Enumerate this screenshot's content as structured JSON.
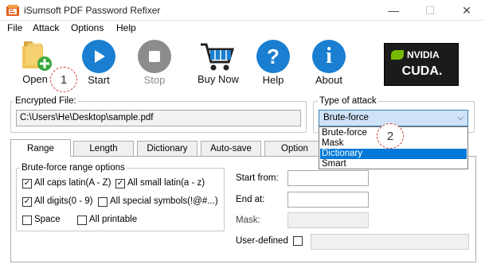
{
  "window": {
    "title": "iSumsoft PDF Password Refixer",
    "minimize": "—",
    "maximize": "☐",
    "close": "✕"
  },
  "menu": [
    "File",
    "Attack",
    "Options",
    "Help"
  ],
  "toolbar": {
    "open": "Open",
    "start": "Start",
    "stop": "Stop",
    "buy_now": "Buy Now",
    "help": "Help",
    "about": "About",
    "nvidia_line1": "NVIDIA",
    "nvidia_line2": "CUDA."
  },
  "callouts": [
    "1",
    "2"
  ],
  "encrypted_file": {
    "label": "Encrypted File:",
    "value": "C:\\Users\\He\\Desktop\\sample.pdf"
  },
  "attack_type": {
    "label": "Type of attack",
    "selected": "Brute-force",
    "options": [
      "Brute-force",
      "Mask",
      "Dictionary",
      "Smart"
    ],
    "highlighted": "Dictionary"
  },
  "tabs": [
    "Range",
    "Length",
    "Dictionary",
    "Auto-save",
    "Option"
  ],
  "range": {
    "group_label": "Brute-force range options",
    "options": [
      {
        "label": "All caps latin(A - Z)",
        "checked": true
      },
      {
        "label": "All small latin(a - z)",
        "checked": true
      },
      {
        "label": "All digits(0 - 9)",
        "checked": true
      },
      {
        "label": "All special symbols(!@#...)",
        "checked": false
      },
      {
        "label": "Space",
        "checked": false
      },
      {
        "label": "All printable",
        "checked": false
      }
    ],
    "start_from_label": "Start from:",
    "start_from_value": "",
    "end_at_label": "End at:",
    "end_at_value": "",
    "mask_label": "Mask:",
    "mask_value": "",
    "user_defined_label": "User-defined",
    "user_defined_value": ""
  },
  "colors": {
    "accent_blue": "#1a7fd0",
    "selection": "#0078d7",
    "callout_border": "#d04040"
  }
}
